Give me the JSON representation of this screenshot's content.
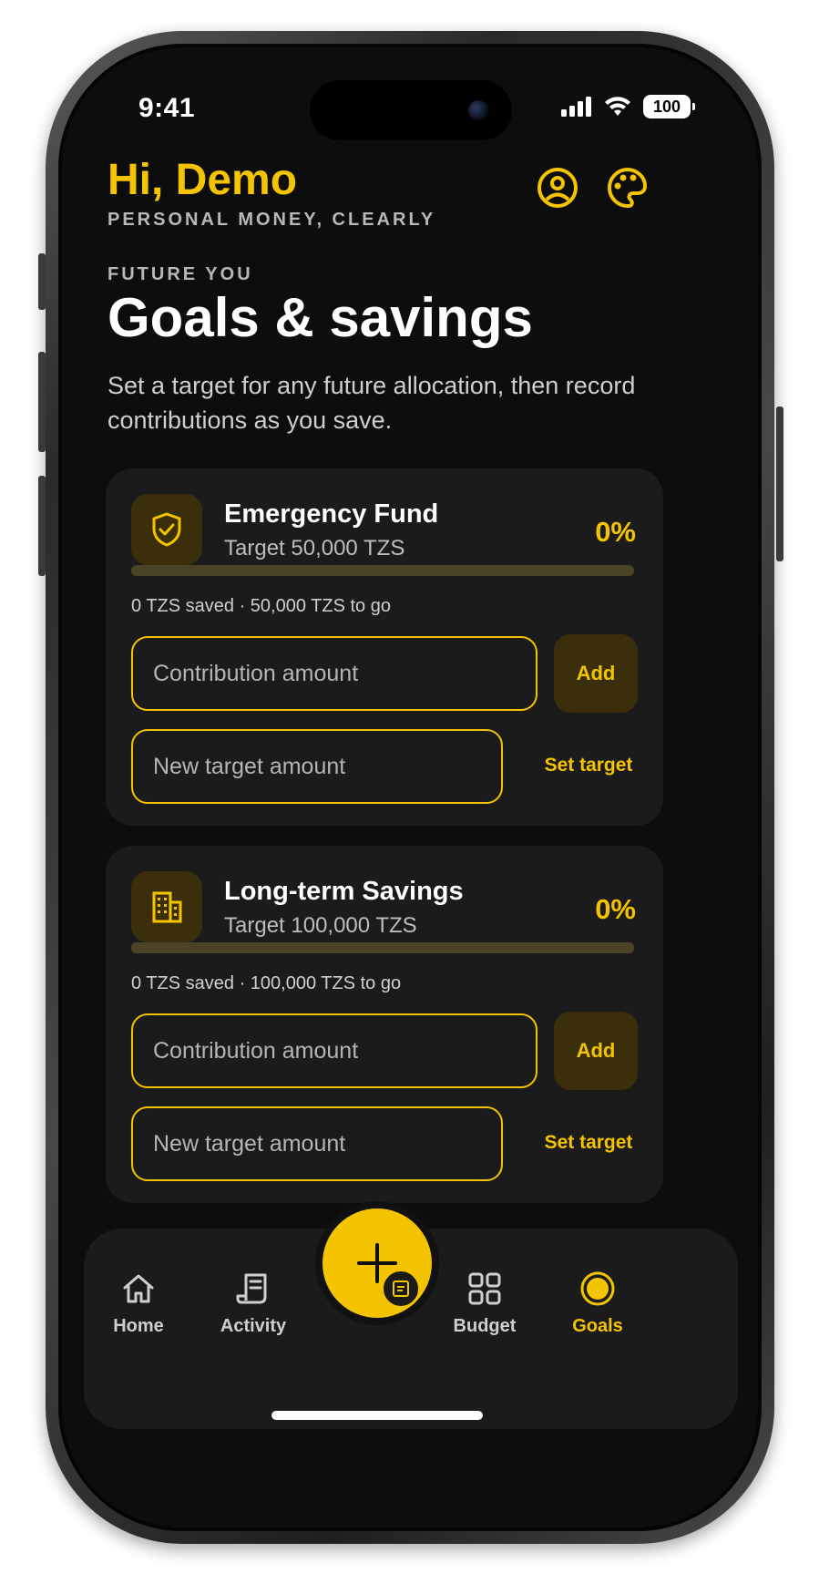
{
  "status_bar": {
    "time": "9:41",
    "battery": "100"
  },
  "header": {
    "greeting": "Hi, Demo",
    "tagline": "PERSONAL MONEY, CLEARLY"
  },
  "page": {
    "kicker": "FUTURE YOU",
    "title": "Goals & savings",
    "description": "Set a target for any future allocation, then record contributions as you save."
  },
  "goals": [
    {
      "name": "Emergency Fund",
      "target": "Target 50,000 TZS",
      "percent": "0%",
      "progress": 0,
      "stats": "0 TZS saved · 50,000 TZS to go",
      "icon": "shield-check-icon",
      "contribution_placeholder": "Contribution amount",
      "add_label": "Add",
      "target_placeholder": "New target amount",
      "set_target_label": "Set target"
    },
    {
      "name": "Long-term Savings",
      "target": "Target 100,000 TZS",
      "percent": "0%",
      "progress": 0,
      "stats": "0 TZS saved · 100,000 TZS to go",
      "icon": "building-icon",
      "contribution_placeholder": "Contribution amount",
      "add_label": "Add",
      "target_placeholder": "New target amount",
      "set_target_label": "Set target"
    }
  ],
  "nav": {
    "items": [
      {
        "label": "Home",
        "icon": "home-icon",
        "active": false
      },
      {
        "label": "Activity",
        "icon": "receipt-icon",
        "active": false
      },
      {
        "label": "Budget",
        "icon": "grid-icon",
        "active": false
      },
      {
        "label": "Goals",
        "icon": "target-icon",
        "active": true
      }
    ],
    "fab_icon": "plus-icon"
  },
  "colors": {
    "accent": "#f5c400",
    "background": "#0d0d0d",
    "card": "#1b1b1b"
  }
}
